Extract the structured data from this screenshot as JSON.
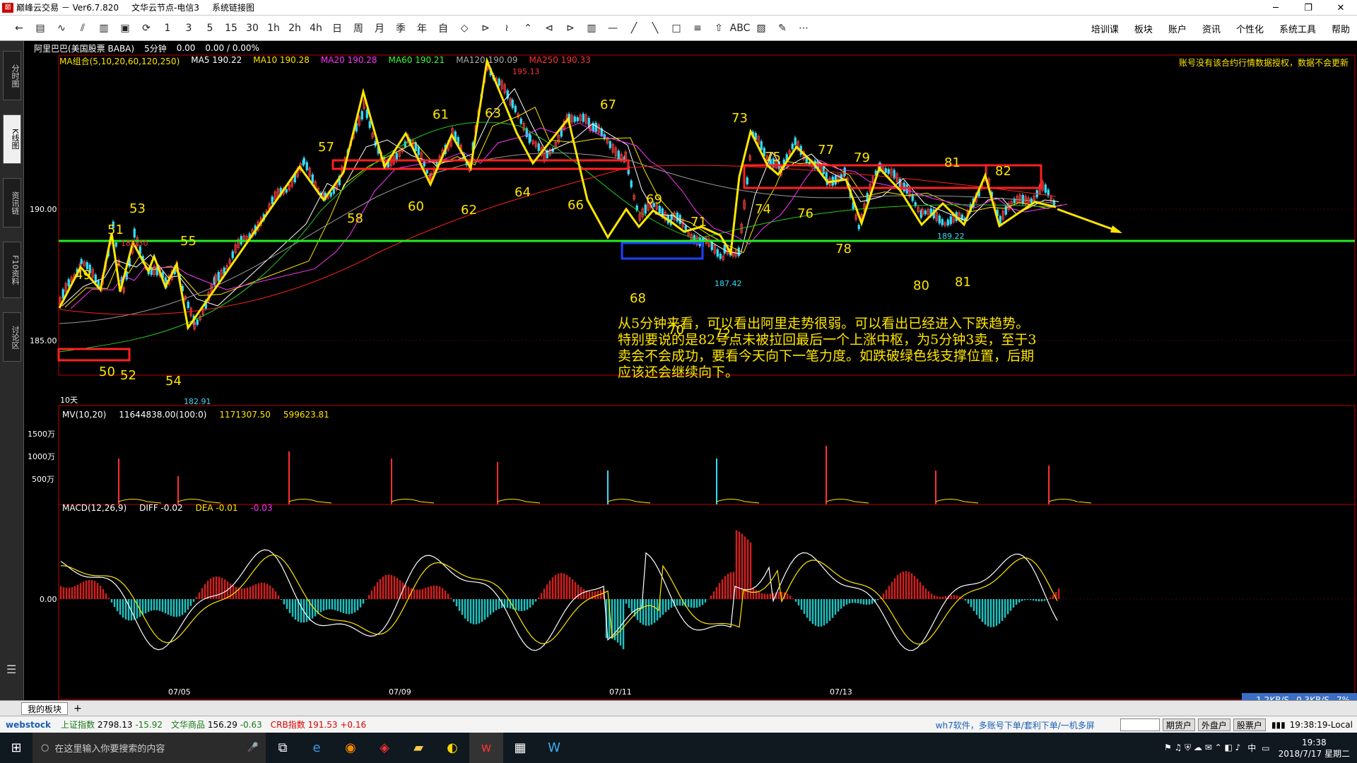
{
  "window": {
    "title": "巅峰云交易 － Ver6.7.820",
    "server": "文华云节点-电信3",
    "menu_system": "系统链接图",
    "min": "─",
    "max": "❐",
    "close": "✕"
  },
  "toolbar": {
    "buttons": [
      "←",
      "▤",
      "∿",
      "⫽",
      "▥",
      "▣",
      "⟳",
      "1",
      "3",
      "5",
      "15",
      "30",
      "1h",
      "2h",
      "4h",
      "日",
      "周",
      "月",
      "季",
      "年",
      "自",
      "◇",
      "⊳",
      "≀",
      "⌃",
      "⊲",
      "⊳",
      "▥",
      "—",
      "╱",
      "╲",
      "□",
      "≡",
      "⇧",
      "ABC",
      "▨",
      "✎",
      "⋯"
    ],
    "menus": [
      "培训课",
      "板块",
      "账户",
      "资讯",
      "个性化",
      "系统工具",
      "帮助"
    ]
  },
  "left_tabs": [
    "分时图",
    "K线图",
    "资讯链",
    "F10资料",
    "讨论区"
  ],
  "info_line": {
    "symbol": "阿里巴巴(美国股票 BABA)",
    "period": "5分钟",
    "price": "0.00",
    "change": "0.00 / 0.00%"
  },
  "ma_line": [
    {
      "label": "MA组合(5,10,20,60,120,250)",
      "color": "#ffe600"
    },
    {
      "label": "MA5 190.22",
      "color": "#ffffff"
    },
    {
      "label": "MA10 190.28",
      "color": "#ffe600"
    },
    {
      "label": "MA20 190.28",
      "color": "#ff33ff"
    },
    {
      "label": "MA60 190.21",
      "color": "#33ff33"
    },
    {
      "label": "MA120 190.09",
      "color": "#aaaaaa"
    },
    {
      "label": "MA250 190.33",
      "color": "#ff3333"
    }
  ],
  "notice": "账号没有该合约行情数据授权，数据不会更新",
  "price_axis": [
    "190.00",
    "185.00"
  ],
  "period_label": "10天",
  "price_marks": [
    {
      "text": "195.13",
      "color": "#ff3333"
    },
    {
      "text": "188.30",
      "color": "#ff3333"
    },
    {
      "text": "182.91",
      "color": "#33ddff"
    },
    {
      "text": "187.42",
      "color": "#33ddff"
    },
    {
      "text": "189.22",
      "color": "#33ddff"
    }
  ],
  "wave_labels": [
    "49",
    "50",
    "51",
    "52",
    "53",
    "54",
    "55",
    "57",
    "58",
    "60",
    "61",
    "62",
    "63",
    "64",
    "66",
    "67",
    "68",
    "69",
    "70",
    "71",
    "72",
    "73",
    "74",
    "75",
    "76",
    "77",
    "78",
    "79",
    "80",
    "81",
    "81",
    "82"
  ],
  "annotation": "从5分钟来看，可以看出阿里走势很弱。可以看出已经进入下跌趋势。特别要说的是82号点未被拉回最后一个上涨中枢，为5分钟3卖，至于3卖会不会成功，要看今天向下一笔力度。如跌破绿色线支撑位置，后期应该还会继续向下。",
  "mv_line": [
    "MV(10,20)",
    "11644838.00(100:0)",
    "1171307.50",
    "599623.81"
  ],
  "mv_axis": [
    "1500万",
    "1000万",
    "500万"
  ],
  "macd_line": [
    "MACD(12,26,9)",
    "DIFF -0.02",
    "DEA -0.01",
    "-0.03"
  ],
  "macd_axis": "0.00",
  "dates": [
    "07/05",
    "07/09",
    "07/11",
    "07/13"
  ],
  "bottom_tab": "我的板块",
  "bottom_plus": "+",
  "netspeed": {
    "down": "1.2KB/S",
    "up": "0.3KB/S",
    "cpu": "7%"
  },
  "status": {
    "brand": "webstock",
    "items": [
      {
        "name": "上证指数",
        "value": "2798.13",
        "change": "-15.92",
        "dir": "down"
      },
      {
        "name": "文华商品",
        "value": "156.29",
        "change": "-0.63",
        "dir": "down"
      },
      {
        "name": "CRB指数",
        "value": "191.53",
        "change": "+0.16",
        "dir": "up"
      }
    ],
    "promo": "wh7软件，多账号下单/套利下单/一机多屏",
    "buttons": [
      "期货户",
      "外盘户",
      "股票户"
    ],
    "time": "19:38:19-Local"
  },
  "taskbar": {
    "search_placeholder": "在这里输入你要搜索的内容",
    "tray": "中",
    "clock_time": "19:38",
    "clock_date": "2018/7/17 星期二"
  }
}
